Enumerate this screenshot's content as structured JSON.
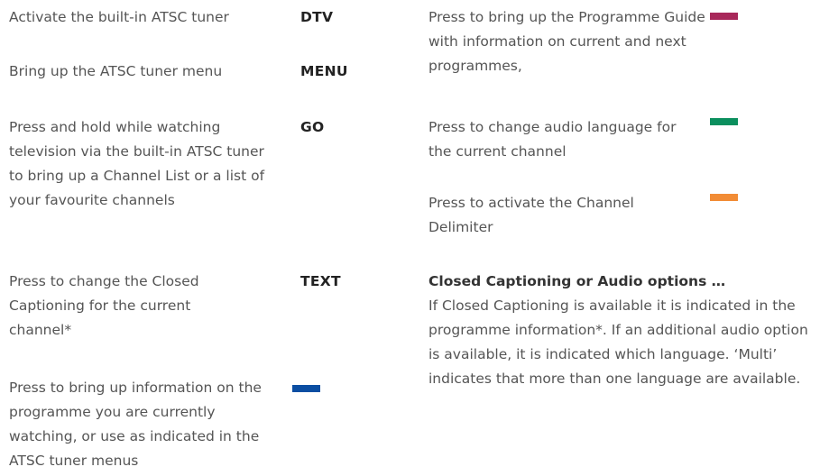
{
  "left_column": {
    "dtv_desc": "Activate the built-in ATSC tuner",
    "menu_desc": "Bring up the ATSC tuner menu",
    "go_desc": "Press and hold while watching television via the built-in ATSC tuner to bring up a Channel List or a list of your favourite channels",
    "text_desc": "Press to change the Closed Captioning for the current channel*",
    "blue_desc": "Press to bring up information on the programme you are currently watching, or use as indicated in the ATSC tuner menus"
  },
  "keys": {
    "dtv": "DTV",
    "menu": "MENU",
    "go": "GO",
    "text": "TEXT"
  },
  "right_column": {
    "red_desc": "Press to bring up the Programme Guide with information on current and next programmes,",
    "green_desc": "Press to change audio language for the current channel",
    "yellow_desc": "Press to activate the Channel Delimiter",
    "cc_heading": "Closed Captioning or Audio options …",
    "cc_body": "If Closed Captioning is available it is indicated in the programme information*. If an additional audio option is available, it is indicated which language. ‘Multi’ indicates that more than one language are available."
  },
  "swatch_colors": {
    "red": "#A8285A",
    "green": "#0B8F5E",
    "yellow": "#F28C35",
    "blue": "#0B4EA2"
  }
}
